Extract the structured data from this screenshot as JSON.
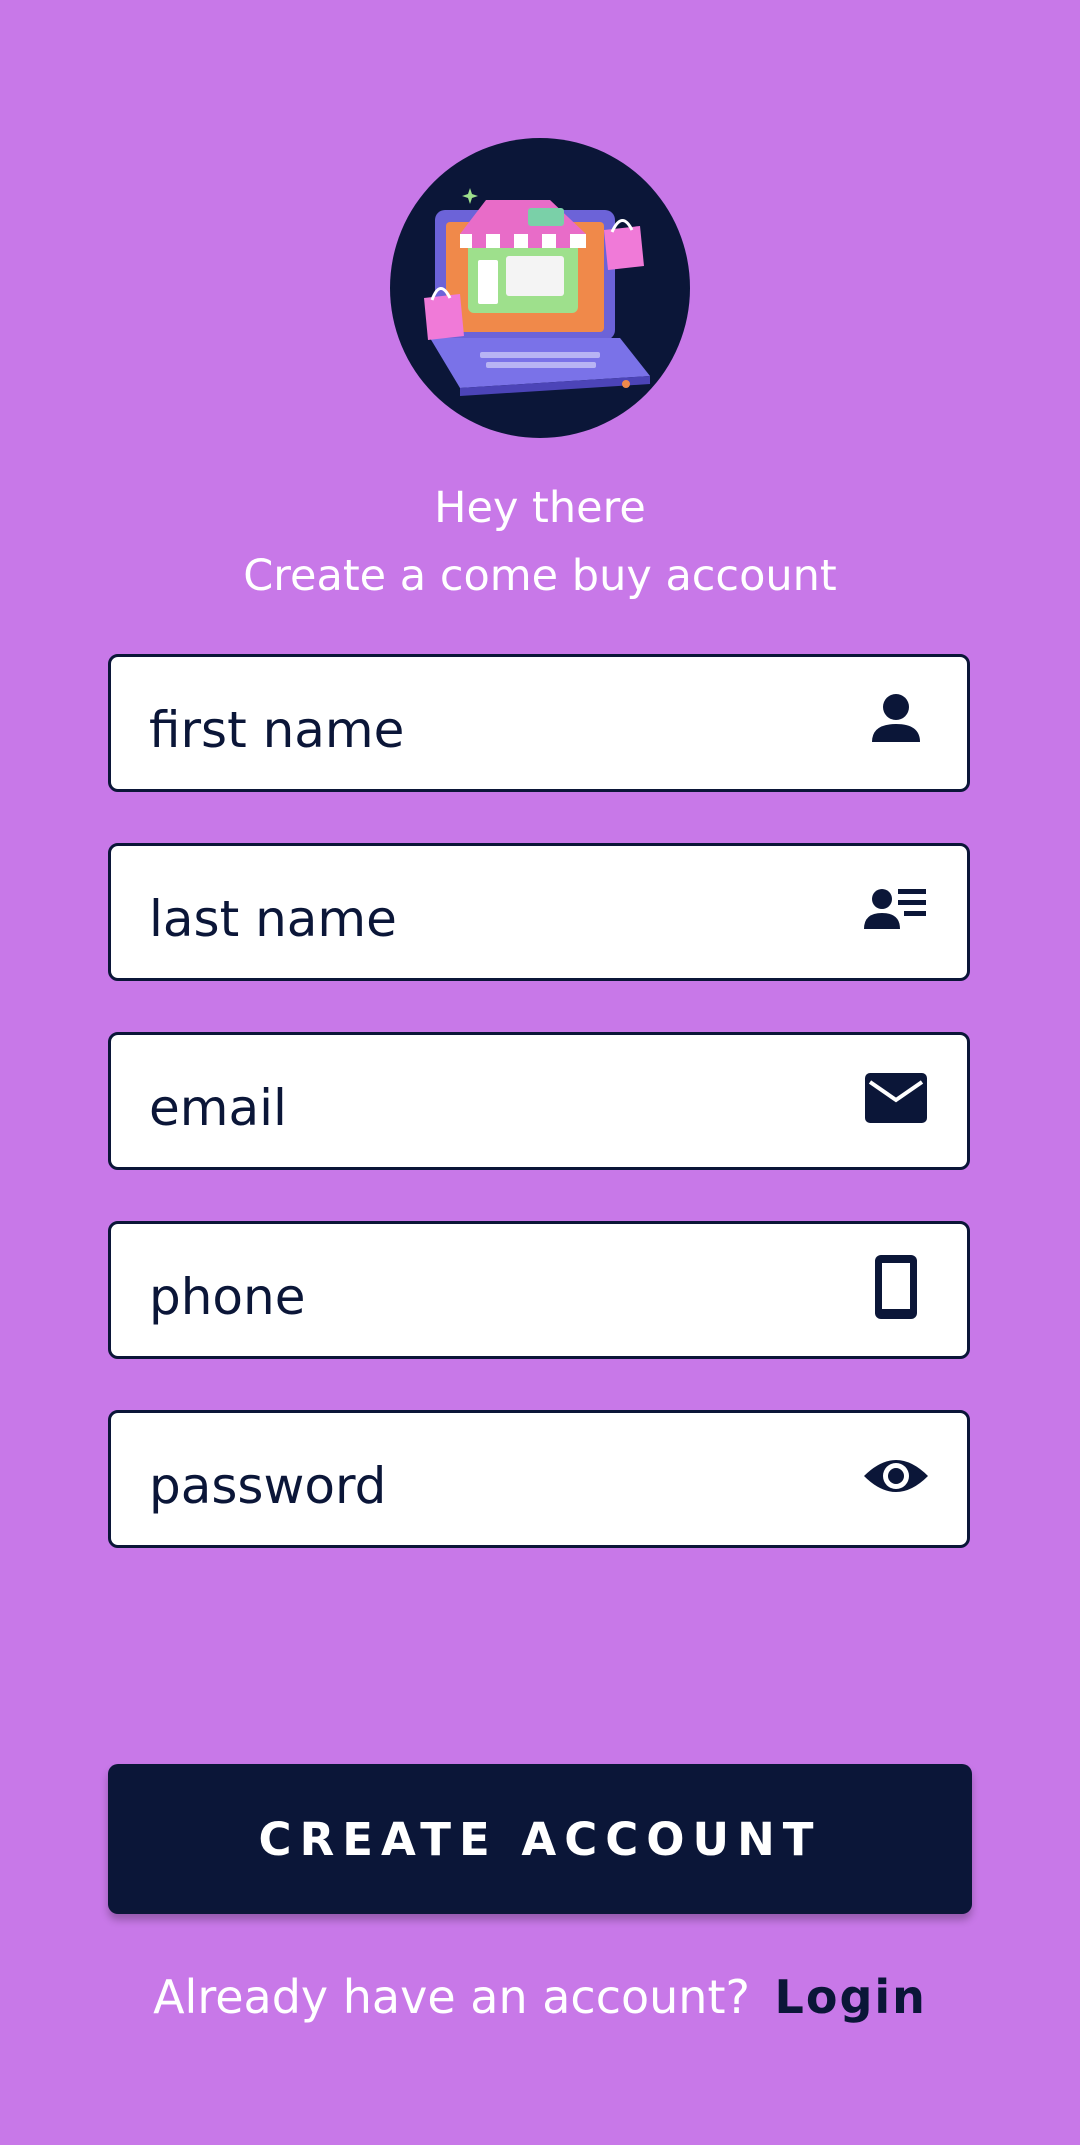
{
  "header": {
    "greeting": "Hey there",
    "subtitle": "Create a come buy account"
  },
  "form": {
    "fields": [
      {
        "placeholder": "first name",
        "icon": "person-icon"
      },
      {
        "placeholder": "last name",
        "icon": "contact-card-icon"
      },
      {
        "placeholder": "email",
        "icon": "envelope-icon"
      },
      {
        "placeholder": "phone",
        "icon": "smartphone-icon"
      },
      {
        "placeholder": "password",
        "icon": "eye-icon"
      }
    ],
    "submit_label": "CREATE ACCOUNT"
  },
  "footer": {
    "prompt": "Already have an account?",
    "login_label": "Login"
  },
  "colors": {
    "background": "#c878e8",
    "navy": "#0b1638",
    "field_bg": "#ffffff"
  }
}
